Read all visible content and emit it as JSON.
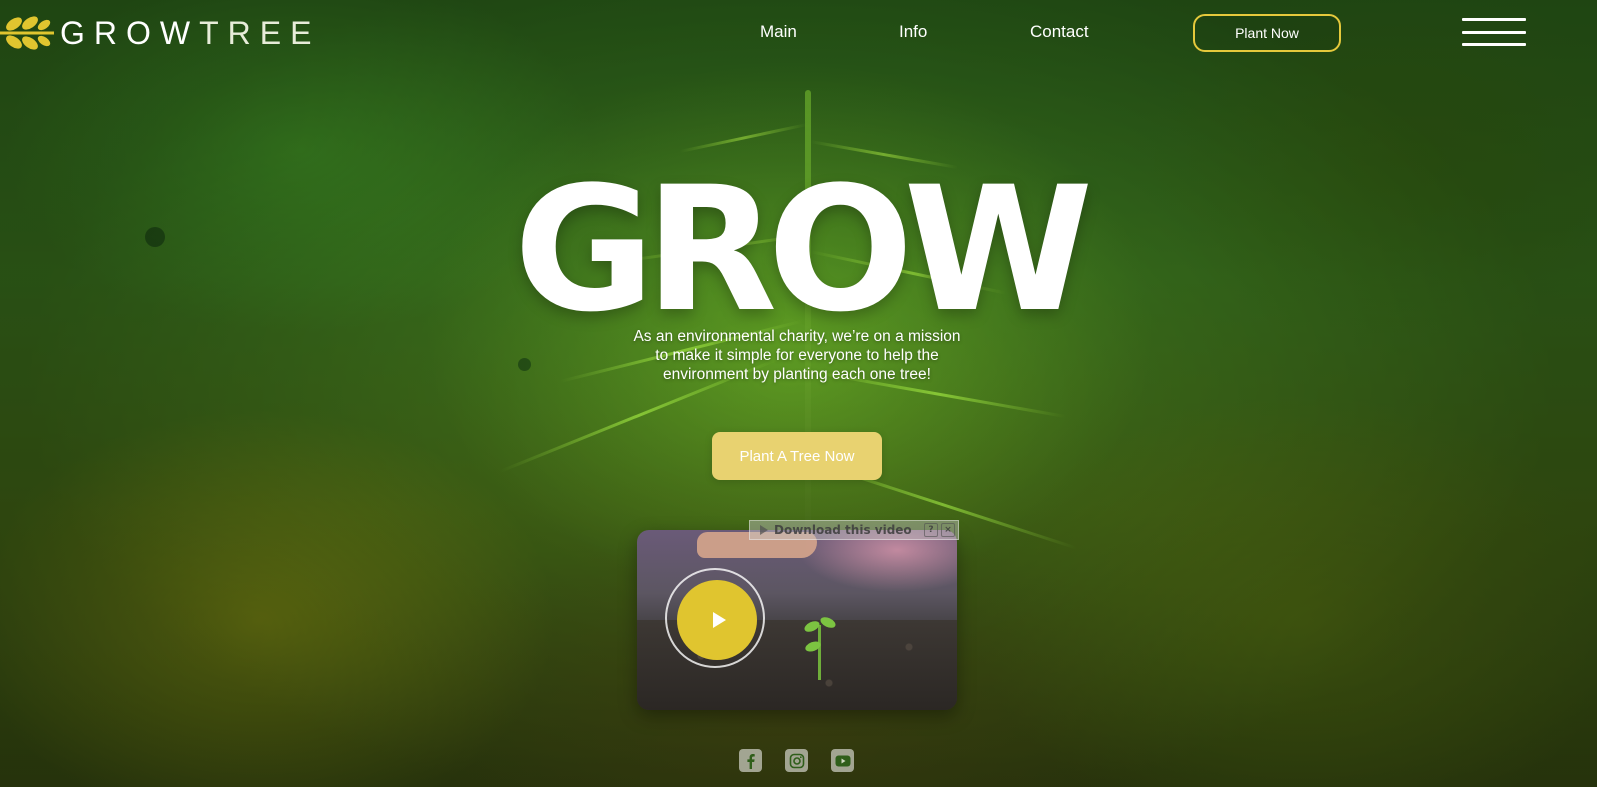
{
  "brand": {
    "word_1": "GROW",
    "word_2": "TREE",
    "logo_icon": "sprout-branch-icon",
    "accent_color": "#e0c52f"
  },
  "nav": {
    "items": [
      {
        "label": "Main"
      },
      {
        "label": "Info"
      },
      {
        "label": "Contact"
      }
    ],
    "plant_now_label": "Plant Now",
    "menu_icon": "hamburger-menu-icon"
  },
  "hero": {
    "title": "GROW",
    "description": "As an environmental charity, we’re on a mission to make it simple for everyone to help the environment by planting each one tree!",
    "cta_label": "Plant A Tree Now"
  },
  "video": {
    "play_icon": "play-icon",
    "download_label": "Download this video",
    "help_label": "?",
    "close_label": "×"
  },
  "social": {
    "icons": [
      "facebook-icon",
      "instagram-icon",
      "youtube-icon"
    ]
  }
}
